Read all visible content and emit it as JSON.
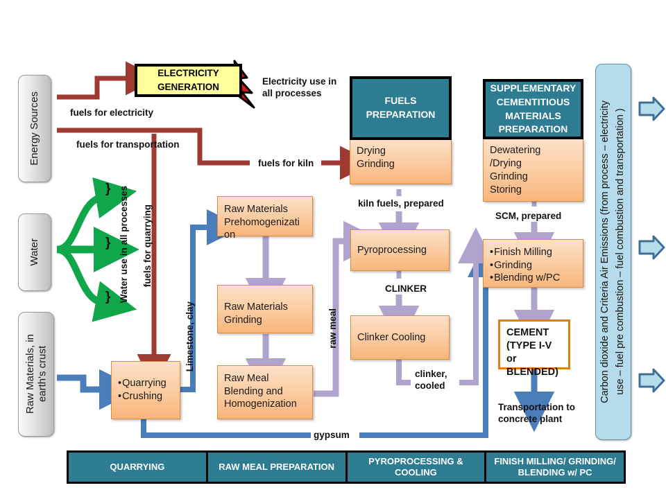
{
  "diagram": {
    "title": "Cement manufacturing process flow diagram",
    "colors": {
      "teal": "#2e7c92",
      "orange_fill": "#fbcfa7",
      "orange_border": "#e07d1c",
      "yellow": "#ffff9e",
      "dark_red_arrow": "#9e3a32",
      "blue_arrow": "#4a7ebb",
      "purple_arrow": "#b0a3ce",
      "green_arrow": "#10a64a",
      "gray_box": "#cfcfcf",
      "light_blue_panel": "#b6dceb"
    }
  },
  "sources": [
    {
      "id": "energy-sources",
      "label": "Energy Sources"
    },
    {
      "id": "water",
      "label": "Water"
    },
    {
      "id": "raw-materials",
      "label": "Raw Materials, in\nearth's crust"
    }
  ],
  "electricity": {
    "label": "ELECTRICITY\nGENERATION",
    "icon": "lightning-bolt-icon",
    "note": "Electricity use in\nall processes"
  },
  "headers": [
    {
      "id": "fuels-preparation",
      "label": "FUELS\nPREPARATION"
    },
    {
      "id": "scm-preparation",
      "label": "SUPPLEMENTARY\nCEMENTITIOUS\nMATERIALS\nPREPARATION"
    }
  ],
  "processes": {
    "fuels_prep_items": [
      "Drying",
      "Grinding"
    ],
    "scm_prep_items": [
      "Dewatering",
      "/Drying",
      "Grinding",
      "Storing"
    ],
    "quarrying_items": [
      "Quarrying",
      "Crushing"
    ],
    "finish_milling_items": [
      "Finish Milling",
      "Grinding",
      "Blending w/PC"
    ],
    "raw_materials_prehomogenization": "Raw Materials Prehomogenizati on",
    "raw_materials_grinding": "Raw Materials Grinding",
    "raw_meal_blending": "Raw Meal Blending and Homogenization",
    "pyroprocessing": "Pyroprocessing",
    "clinker_cooling": "Clinker Cooling",
    "cement": "CEMENT\n(TYPE I-V or\nBLENDED)"
  },
  "flow_labels": {
    "fuels_for_electricity": "fuels for electricity",
    "fuels_for_transportation": "fuels for transportation",
    "fuels_for_kiln": "fuels for kiln",
    "fuels_for_quarrying": "fuels for quarrying",
    "water_use": "Water use in all processes",
    "limestone_clay": "Limestone, clay",
    "raw_meal": "raw  meal",
    "kiln_fuels_prepared": "kiln fuels, prepared",
    "scm_prepared": "SCM, prepared",
    "clinker": "CLINKER",
    "clinker_cooled": "clinker,\ncooled",
    "gypsum": "gypsum",
    "transportation": "Transportation to\nconcrete plant"
  },
  "emissions_panel": {
    "label": "Carbon dioxide and Criteria Air Emissions (from process – electricity\nuse – fuel  pre combustion –  fuel combustion  and transportation )",
    "arrows": 3
  },
  "stage_bar": {
    "cells": [
      "QUARRYING",
      "RAW MEAL PREPARATION",
      "PYROPROCESSING &\nCOOLING",
      "FINISH MILLING/ GRINDING/\nBLENDING w/ PC"
    ]
  }
}
